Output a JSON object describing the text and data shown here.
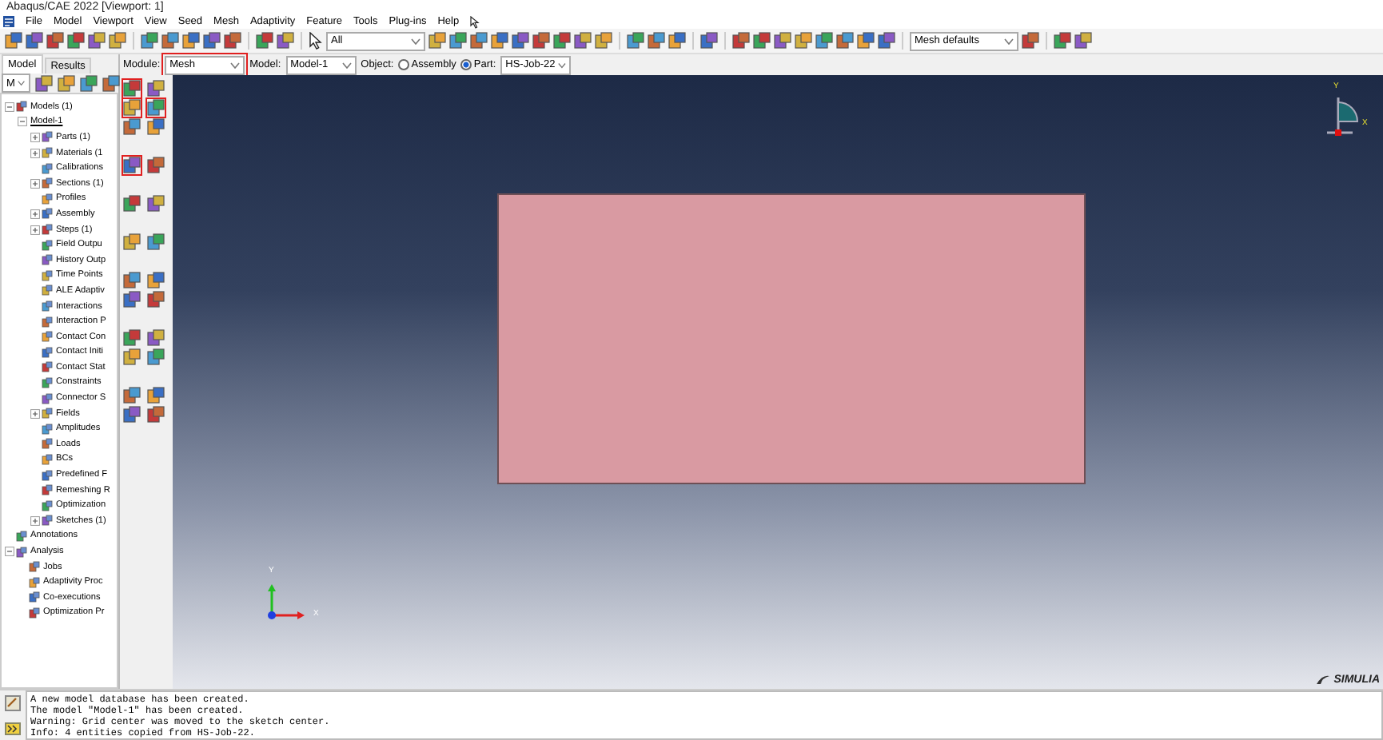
{
  "window": {
    "title": "Abaqus/CAE 2022 [Viewport: 1]"
  },
  "menu": [
    "File",
    "Model",
    "Viewport",
    "View",
    "Seed",
    "Mesh",
    "Adaptivity",
    "Feature",
    "Tools",
    "Plug-ins",
    "Help"
  ],
  "toolbar": {
    "selection_filter": {
      "value": "All"
    },
    "mesh_display": {
      "value": "Mesh defaults"
    }
  },
  "context_bar": {
    "module": {
      "label": "Module:",
      "value": "Mesh",
      "highlighted": true
    },
    "model": {
      "label": "Model:",
      "value": "Model-1"
    },
    "object": {
      "label": "Object:",
      "options": [
        {
          "label": "Assembly",
          "selected": false
        },
        {
          "label": "Part:",
          "selected": true
        }
      ]
    },
    "part": {
      "value": "HS-Job-22"
    }
  },
  "tabs": [
    {
      "label": "Model",
      "selected": true
    },
    {
      "label": "Results",
      "selected": false
    }
  ],
  "tree_filter": {
    "value": "M"
  },
  "tree": [
    {
      "label": "Models (1)",
      "expandable": true,
      "expanded": true,
      "children": [
        {
          "label": "Model-1",
          "expandable": true,
          "expanded": true,
          "children": [
            {
              "label": "Parts (1)",
              "expandable": true,
              "expanded": false
            },
            {
              "label": "Materials (1",
              "expandable": true,
              "expanded": false
            },
            {
              "label": "Calibrations",
              "expandable": false
            },
            {
              "label": "Sections (1)",
              "expandable": true,
              "expanded": false
            },
            {
              "label": "Profiles",
              "expandable": false
            },
            {
              "label": "Assembly",
              "expandable": true,
              "expanded": false
            },
            {
              "label": "Steps (1)",
              "expandable": true,
              "expanded": false
            },
            {
              "label": "Field Outpu",
              "expandable": false
            },
            {
              "label": "History Outp",
              "expandable": false
            },
            {
              "label": "Time Points",
              "expandable": false
            },
            {
              "label": "ALE Adaptiv",
              "expandable": false
            },
            {
              "label": "Interactions",
              "expandable": false
            },
            {
              "label": "Interaction P",
              "expandable": false
            },
            {
              "label": "Contact Con",
              "expandable": false
            },
            {
              "label": "Contact Initi",
              "expandable": false
            },
            {
              "label": "Contact Stat",
              "expandable": false
            },
            {
              "label": "Constraints",
              "expandable": false
            },
            {
              "label": "Connector S",
              "expandable": false
            },
            {
              "label": "Fields",
              "expandable": true,
              "expanded": false
            },
            {
              "label": "Amplitudes",
              "expandable": false
            },
            {
              "label": "Loads",
              "expandable": false
            },
            {
              "label": "BCs",
              "expandable": false
            },
            {
              "label": "Predefined F",
              "expandable": false
            },
            {
              "label": "Remeshing R",
              "expandable": false
            },
            {
              "label": "Optimization",
              "expandable": false
            },
            {
              "label": "Sketches (1)",
              "expandable": true,
              "expanded": false
            }
          ]
        }
      ]
    },
    {
      "label": "Annotations",
      "expandable": false
    },
    {
      "label": "Analysis",
      "expandable": true,
      "expanded": true,
      "children": [
        {
          "label": "Jobs",
          "expandable": false
        },
        {
          "label": "Adaptivity Proc",
          "expandable": false
        },
        {
          "label": "Co-executions",
          "expandable": false
        },
        {
          "label": "Optimization Pr",
          "expandable": false
        }
      ]
    }
  ],
  "toolbox": [
    {
      "highlighted": true
    },
    {
      "highlighted": false
    },
    {
      "highlighted": true
    },
    {
      "highlighted": true
    },
    {
      "highlighted": false
    },
    {
      "highlighted": false
    },
    {
      "highlighted": true
    },
    {
      "highlighted": false
    },
    {
      "highlighted": false
    },
    {
      "highlighted": false
    },
    {
      "highlighted": false
    },
    {
      "highlighted": false
    },
    {
      "highlighted": false
    },
    {
      "highlighted": false
    },
    {
      "highlighted": false
    },
    {
      "highlighted": false
    },
    {
      "highlighted": false
    },
    {
      "highlighted": false
    },
    {
      "highlighted": false
    },
    {
      "highlighted": false
    },
    {
      "highlighted": false
    },
    {
      "highlighted": false
    },
    {
      "highlighted": false
    },
    {
      "highlighted": false
    }
  ],
  "viewport": {
    "view_triad": {
      "y": "Y",
      "x": "X"
    },
    "axis_triad": {
      "y": "Y",
      "x": "X"
    },
    "logo": "SIMULIA"
  },
  "messages": [
    "A new model database has been created.",
    "The model \"Model-1\" has been created.",
    "Warning: Grid center was moved to the sketch center.",
    "Info: 4 entities copied from HS-Job-22."
  ]
}
